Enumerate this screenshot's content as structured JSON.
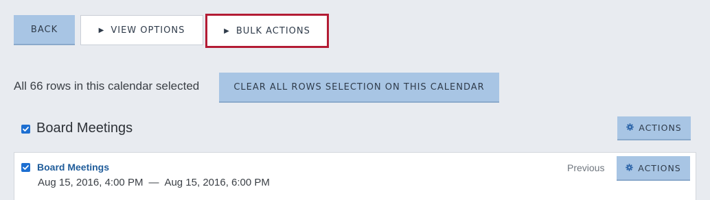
{
  "toolbar": {
    "back_label": "BACK",
    "view_options_label": "VIEW OPTIONS",
    "bulk_actions_label": "BULK ACTIONS"
  },
  "selection": {
    "status_text": "All 66 rows in this calendar selected",
    "clear_label": "CLEAR ALL ROWS SELECTION ON THIS CALENDAR"
  },
  "group": {
    "title": "Board Meetings",
    "checked": true,
    "actions_label": "ACTIONS"
  },
  "event": {
    "title": "Board Meetings",
    "checked": true,
    "start": "Aug 15, 2016, 4:00 PM",
    "separator": "—",
    "end": "Aug 15, 2016, 6:00 PM",
    "previous_label": "Previous",
    "actions_label": "ACTIONS"
  },
  "colors": {
    "background": "#e8ebf0",
    "button_blue": "#a8c5e4",
    "highlight_border": "#b31b34",
    "link": "#1f5c9a",
    "checkbox": "#1d6fd1"
  },
  "icons": {
    "expand": "triangle-right-icon",
    "actions": "gear-icon",
    "checkbox": "checkmark-icon"
  }
}
